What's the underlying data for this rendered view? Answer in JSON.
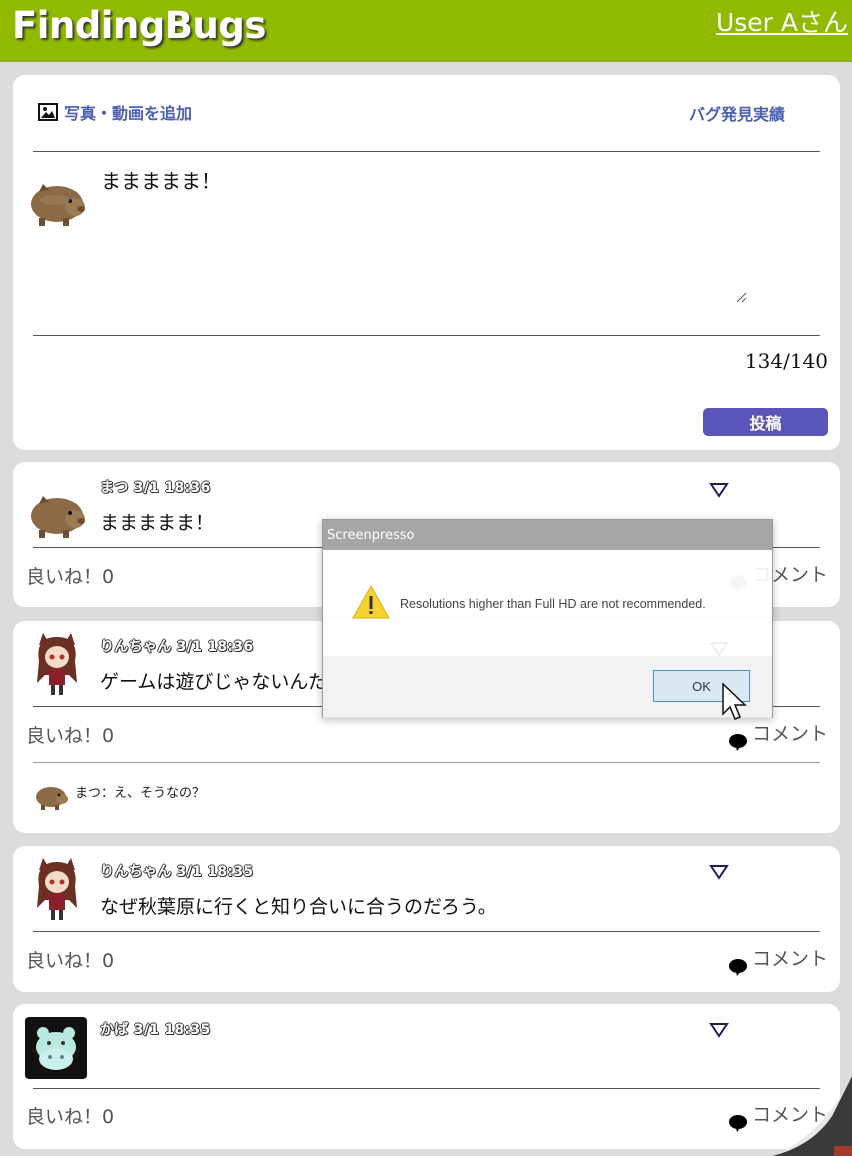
{
  "header": {
    "logo": "FindingBugs",
    "user_link": "User Aさん"
  },
  "composer": {
    "add_media_label": "写真・動画を追加",
    "bug_record_label": "バグ発見実績",
    "text_value": "ままままま！",
    "counter": "134/140",
    "post_button": "投稿"
  },
  "posts": [
    {
      "meta": "まつ 3/1 18:36",
      "text": "ままままま！",
      "like": "良いね！0",
      "comment": "コメント"
    },
    {
      "meta": "りんちゃん 3/1 18:36",
      "text": "ゲームは遊びじゃないんだ！",
      "like": "良いね！0",
      "comment": "コメント",
      "reply": "まつ：え、そうなの？"
    },
    {
      "meta": "りんちゃん 3/1 18:35",
      "text": "なぜ秋葉原に行くと知り合いに合うのだろう。",
      "like": "良いね！0",
      "comment": "コメント"
    },
    {
      "meta": "かば 3/1 18:35",
      "text": "",
      "like": "良いね！0",
      "comment": "コメント"
    }
  ],
  "dialog": {
    "title": "Screenpresso",
    "message": "Resolutions higher than Full HD are not recommended.",
    "ok": "OK"
  },
  "colors": {
    "header": "#8fba00",
    "accent": "#5a55b8",
    "link": "#4d5fb0"
  }
}
